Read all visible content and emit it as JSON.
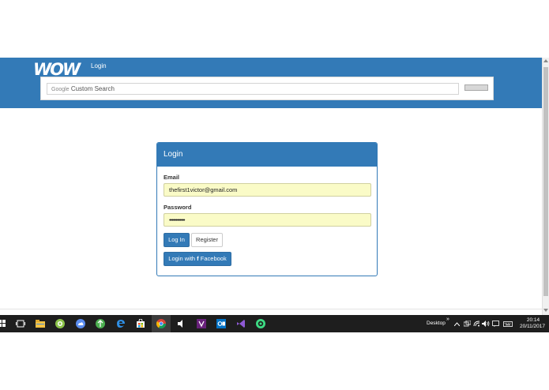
{
  "browser": {
    "header": {
      "logo_text": "WOW",
      "nav_login": "Login",
      "search": {
        "google_label": "Google",
        "placeholder_text": "Custom Search",
        "value": ""
      }
    },
    "login_panel": {
      "title": "Login",
      "email_label": "Email",
      "email_value": "thefirst1victor@gmail.com",
      "password_label": "Password",
      "password_value": "••••••••••••",
      "login_button": "Log In",
      "register_button": "Register",
      "facebook_button_prefix": "Login with",
      "facebook_glyph": "f",
      "facebook_button_suffix": "Facebook"
    }
  },
  "taskbar": {
    "icons": [
      "start-icon",
      "task-view-icon",
      "file-explorer-icon",
      "android-app-icon",
      "cloud-app-icon",
      "green-app-icon",
      "edge-icon",
      "store-icon",
      "chrome-icon",
      "media-icon",
      "visual-studio-purple-icon",
      "outlook-icon",
      "visual-studio-icon",
      "android-studio-icon"
    ],
    "tray": {
      "desktop_label": "Desktop",
      "chevron": "»",
      "time": "20:14",
      "date": "20/11/2017"
    }
  },
  "colors": {
    "brand_blue": "#337ab7",
    "autofill_yellow": "#fafbc7",
    "taskbar_bg": "#1e1e1e"
  }
}
